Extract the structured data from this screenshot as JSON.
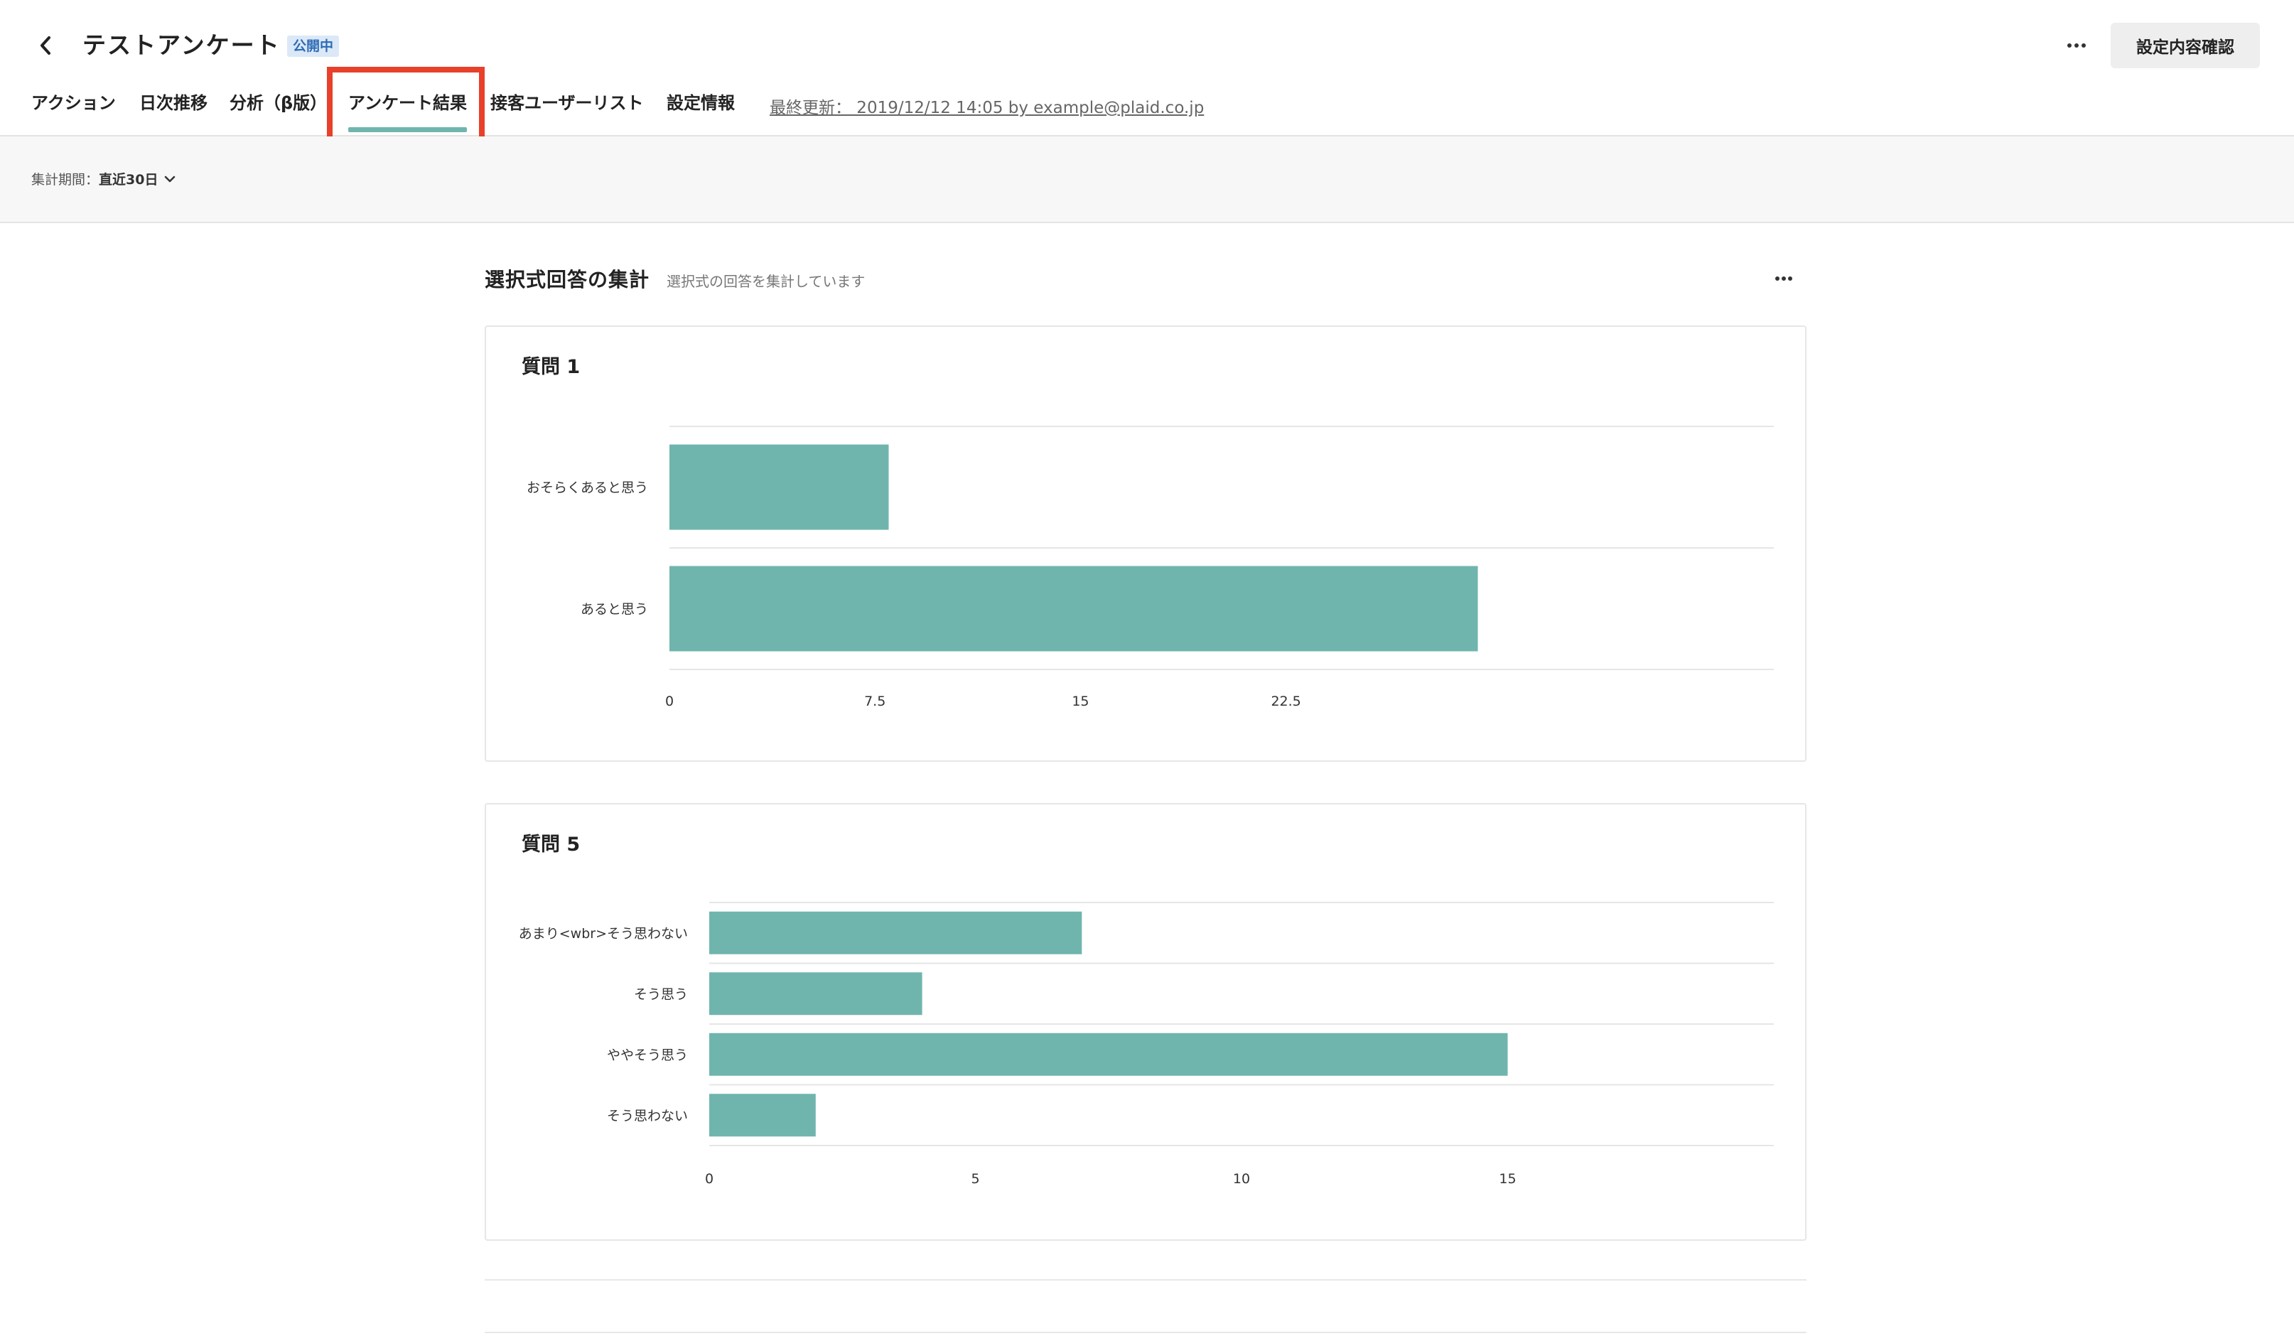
{
  "header": {
    "back_icon": "chevron-left-icon",
    "title": "テストアンケート",
    "status_badge": "公開中",
    "more_icon": "ellipsis-icon",
    "confirm_button": "設定内容確認"
  },
  "tabs": [
    {
      "label": "アクション",
      "active": false
    },
    {
      "label": "日次推移",
      "active": false
    },
    {
      "label": "分析（β版）",
      "active": false
    },
    {
      "label": "アンケート結果",
      "active": true
    },
    {
      "label": "接客ユーザーリスト",
      "active": false
    },
    {
      "label": "設定情報",
      "active": false
    }
  ],
  "last_updated": "最終更新： 2019/12/12 14:05 by example@plaid.co.jp",
  "filter": {
    "label": "集計期間：",
    "value": "直近30日",
    "icon": "chevron-down-icon"
  },
  "section": {
    "title": "選択式回答の集計",
    "subtitle": "選択式の回答を集計しています",
    "more_icon": "ellipsis-icon"
  },
  "colors": {
    "bar": "#6fb5ad",
    "accent": "#6fb5ad",
    "highlight": "#e8402a",
    "badge_bg": "#dbe8f7",
    "badge_text": "#2d6cb5"
  },
  "chart_data": [
    {
      "type": "bar",
      "orientation": "horizontal",
      "title": "質問 1",
      "categories": [
        "おそらくあると思う",
        "あると思う"
      ],
      "values": [
        8,
        29.5
      ],
      "xticks": [
        "0",
        "7.5",
        "15",
        "22.5"
      ],
      "xlim": [
        0,
        40.3
      ],
      "grid": true
    },
    {
      "type": "bar",
      "orientation": "horizontal",
      "title": "質問 5",
      "categories": [
        "あまり<wbr>そう思わない",
        "そう思う",
        "ややそう思う",
        "そう思わない"
      ],
      "values": [
        7,
        4,
        15,
        2
      ],
      "xticks": [
        "0",
        "5",
        "10",
        "15"
      ],
      "xlim": [
        0,
        20
      ],
      "grid": true
    }
  ]
}
